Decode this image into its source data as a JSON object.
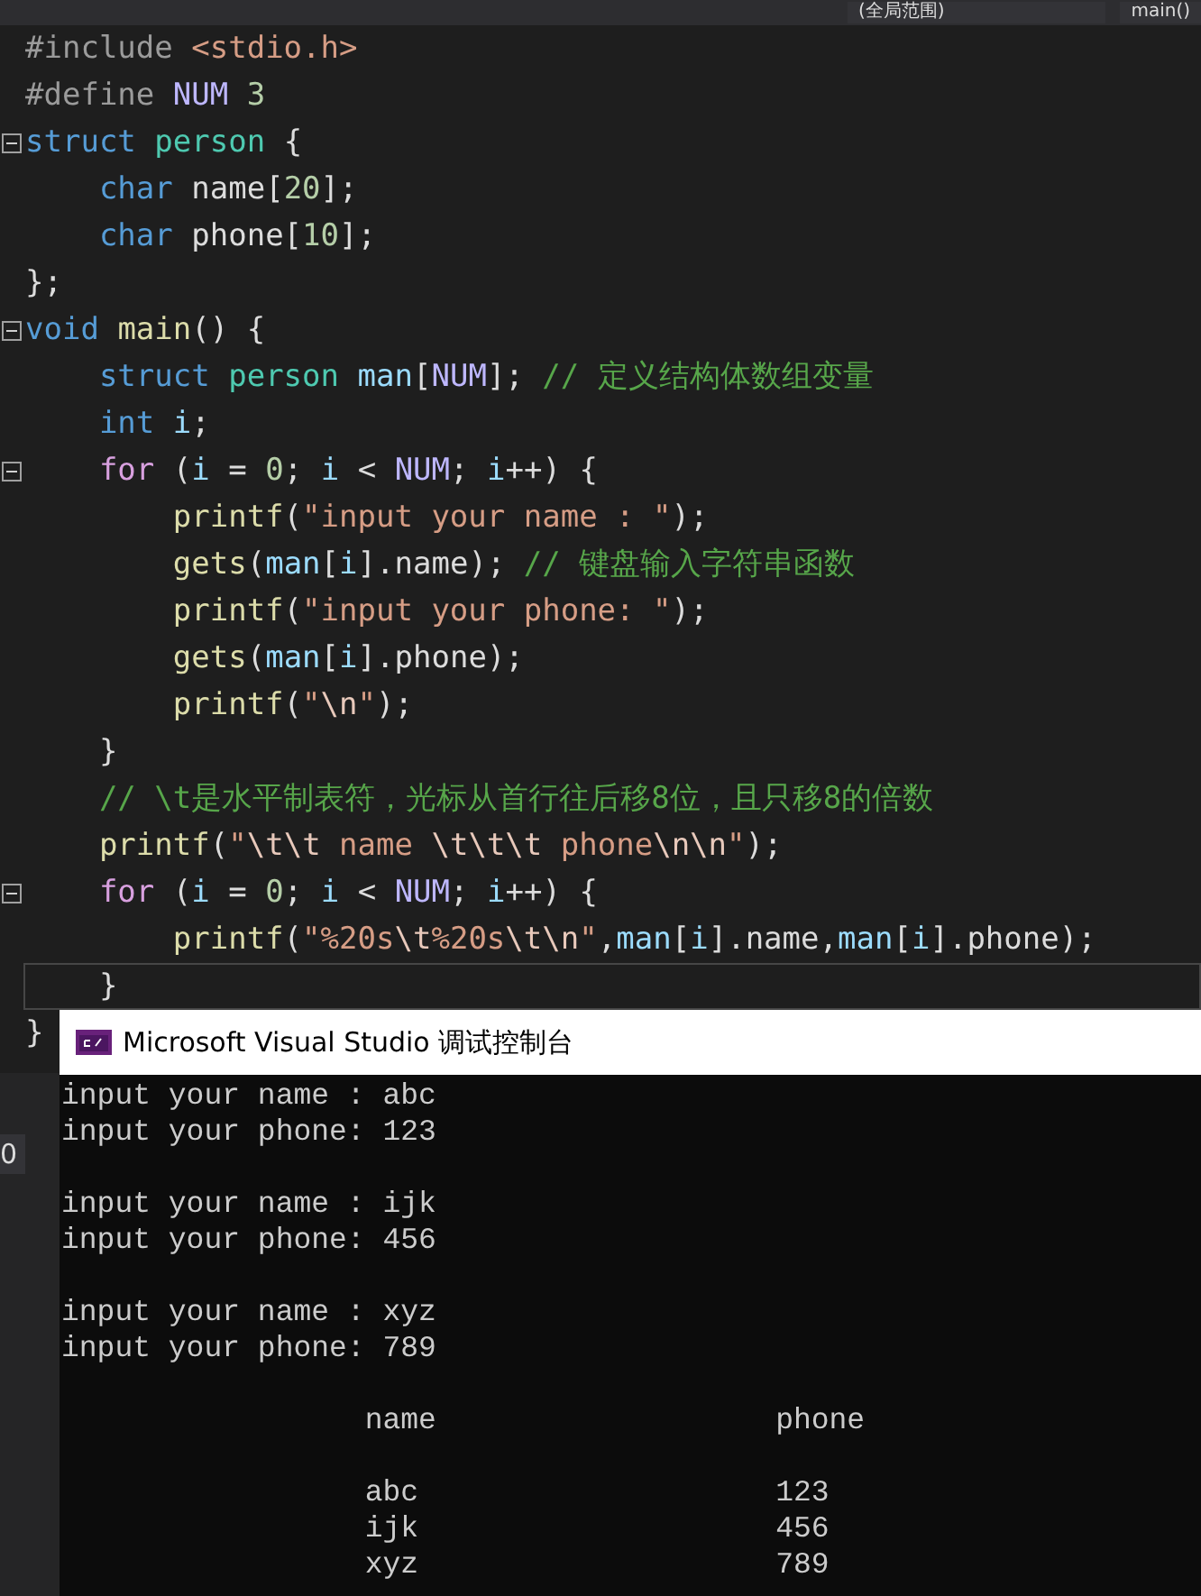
{
  "navigation_bar": {
    "scope_dropdown": "(全局范围)",
    "member_dropdown": "main()"
  },
  "editor": {
    "lines": [
      {
        "fold": false,
        "current": false,
        "tokens": [
          {
            "t": "#include ",
            "kind": "preproc"
          },
          {
            "t": "<stdio.h>",
            "kind": "string"
          }
        ]
      },
      {
        "fold": false,
        "current": false,
        "tokens": [
          {
            "t": "#define ",
            "kind": "preproc"
          },
          {
            "t": "NUM",
            "kind": "macro"
          },
          {
            "t": " 3",
            "kind": "number"
          }
        ]
      },
      {
        "fold": true,
        "current": false,
        "tokens": [
          {
            "t": "struct",
            "kind": "keyword"
          },
          {
            "t": " person",
            "kind": "type"
          },
          {
            "t": " {",
            "kind": "plain"
          }
        ]
      },
      {
        "fold": false,
        "current": false,
        "tokens": [
          {
            "t": "    char",
            "kind": "keyword"
          },
          {
            "t": " name[",
            "kind": "plain"
          },
          {
            "t": "20",
            "kind": "number"
          },
          {
            "t": "];",
            "kind": "plain"
          }
        ]
      },
      {
        "fold": false,
        "current": false,
        "tokens": [
          {
            "t": "    char",
            "kind": "keyword"
          },
          {
            "t": " phone[",
            "kind": "plain"
          },
          {
            "t": "10",
            "kind": "number"
          },
          {
            "t": "];",
            "kind": "plain"
          }
        ]
      },
      {
        "fold": false,
        "current": false,
        "tokens": [
          {
            "t": "};",
            "kind": "plain"
          }
        ]
      },
      {
        "fold": true,
        "current": false,
        "tokens": [
          {
            "t": "void",
            "kind": "keyword"
          },
          {
            "t": " main",
            "kind": "function"
          },
          {
            "t": "() {",
            "kind": "plain"
          }
        ]
      },
      {
        "fold": false,
        "current": false,
        "tokens": [
          {
            "t": "    struct",
            "kind": "keyword"
          },
          {
            "t": " person",
            "kind": "type"
          },
          {
            "t": " man",
            "kind": "variable"
          },
          {
            "t": "[",
            "kind": "plain"
          },
          {
            "t": "NUM",
            "kind": "macro"
          },
          {
            "t": "]; ",
            "kind": "plain"
          },
          {
            "t": "// 定义结构体数组变量",
            "kind": "comment"
          }
        ]
      },
      {
        "fold": false,
        "current": false,
        "tokens": [
          {
            "t": "    int",
            "kind": "keyword"
          },
          {
            "t": " i",
            "kind": "variable"
          },
          {
            "t": ";",
            "kind": "plain"
          }
        ]
      },
      {
        "fold": true,
        "current": false,
        "tokens": [
          {
            "t": "    for",
            "kind": "control"
          },
          {
            "t": " (",
            "kind": "plain"
          },
          {
            "t": "i",
            "kind": "variable"
          },
          {
            "t": " = ",
            "kind": "plain"
          },
          {
            "t": "0",
            "kind": "number"
          },
          {
            "t": "; ",
            "kind": "plain"
          },
          {
            "t": "i",
            "kind": "variable"
          },
          {
            "t": " < ",
            "kind": "plain"
          },
          {
            "t": "NUM",
            "kind": "macro"
          },
          {
            "t": "; ",
            "kind": "plain"
          },
          {
            "t": "i",
            "kind": "variable"
          },
          {
            "t": "++) {",
            "kind": "plain"
          }
        ]
      },
      {
        "fold": false,
        "current": false,
        "tokens": [
          {
            "t": "        printf",
            "kind": "function"
          },
          {
            "t": "(",
            "kind": "plain"
          },
          {
            "t": "\"input your name : \"",
            "kind": "string"
          },
          {
            "t": ");",
            "kind": "plain"
          }
        ]
      },
      {
        "fold": false,
        "current": false,
        "tokens": [
          {
            "t": "        gets",
            "kind": "function"
          },
          {
            "t": "(",
            "kind": "plain"
          },
          {
            "t": "man",
            "kind": "variable"
          },
          {
            "t": "[",
            "kind": "plain"
          },
          {
            "t": "i",
            "kind": "variable"
          },
          {
            "t": "].name); ",
            "kind": "plain"
          },
          {
            "t": "// 键盘输入字符串函数",
            "kind": "comment"
          }
        ]
      },
      {
        "fold": false,
        "current": false,
        "tokens": [
          {
            "t": "        printf",
            "kind": "function"
          },
          {
            "t": "(",
            "kind": "plain"
          },
          {
            "t": "\"input your phone: \"",
            "kind": "string"
          },
          {
            "t": ");",
            "kind": "plain"
          }
        ]
      },
      {
        "fold": false,
        "current": false,
        "tokens": [
          {
            "t": "        gets",
            "kind": "function"
          },
          {
            "t": "(",
            "kind": "plain"
          },
          {
            "t": "man",
            "kind": "variable"
          },
          {
            "t": "[",
            "kind": "plain"
          },
          {
            "t": "i",
            "kind": "variable"
          },
          {
            "t": "].phone);",
            "kind": "plain"
          }
        ]
      },
      {
        "fold": false,
        "current": false,
        "tokens": [
          {
            "t": "        printf",
            "kind": "function"
          },
          {
            "t": "(",
            "kind": "plain"
          },
          {
            "t": "\"",
            "kind": "string"
          },
          {
            "t": "\\n",
            "kind": "escape"
          },
          {
            "t": "\"",
            "kind": "string"
          },
          {
            "t": ");",
            "kind": "plain"
          }
        ]
      },
      {
        "fold": false,
        "current": false,
        "tokens": [
          {
            "t": "    }",
            "kind": "plain"
          }
        ]
      },
      {
        "fold": false,
        "current": false,
        "tokens": [
          {
            "t": "    // \\t是水平制表符，光标从首行往后移8位，且只移8的倍数",
            "kind": "comment"
          }
        ]
      },
      {
        "fold": false,
        "current": false,
        "tokens": [
          {
            "t": "    printf",
            "kind": "function"
          },
          {
            "t": "(",
            "kind": "plain"
          },
          {
            "t": "\"",
            "kind": "string"
          },
          {
            "t": "\\t\\t",
            "kind": "escape"
          },
          {
            "t": " name ",
            "kind": "string"
          },
          {
            "t": "\\t\\t\\t",
            "kind": "escape"
          },
          {
            "t": " phone",
            "kind": "string"
          },
          {
            "t": "\\n\\n",
            "kind": "escape"
          },
          {
            "t": "\"",
            "kind": "string"
          },
          {
            "t": ");",
            "kind": "plain"
          }
        ]
      },
      {
        "fold": true,
        "current": false,
        "tokens": [
          {
            "t": "    for",
            "kind": "control"
          },
          {
            "t": " (",
            "kind": "plain"
          },
          {
            "t": "i",
            "kind": "variable"
          },
          {
            "t": " = ",
            "kind": "plain"
          },
          {
            "t": "0",
            "kind": "number"
          },
          {
            "t": "; ",
            "kind": "plain"
          },
          {
            "t": "i",
            "kind": "variable"
          },
          {
            "t": " < ",
            "kind": "plain"
          },
          {
            "t": "NUM",
            "kind": "macro"
          },
          {
            "t": "; ",
            "kind": "plain"
          },
          {
            "t": "i",
            "kind": "variable"
          },
          {
            "t": "++) {",
            "kind": "plain"
          }
        ]
      },
      {
        "fold": false,
        "current": false,
        "tokens": [
          {
            "t": "        printf",
            "kind": "function"
          },
          {
            "t": "(",
            "kind": "plain"
          },
          {
            "t": "\"%20s",
            "kind": "string"
          },
          {
            "t": "\\t",
            "kind": "escape"
          },
          {
            "t": "%20s",
            "kind": "string"
          },
          {
            "t": "\\t\\n",
            "kind": "escape"
          },
          {
            "t": "\"",
            "kind": "string"
          },
          {
            "t": ",",
            "kind": "plain"
          },
          {
            "t": "man",
            "kind": "variable"
          },
          {
            "t": "[",
            "kind": "plain"
          },
          {
            "t": "i",
            "kind": "variable"
          },
          {
            "t": "].name,",
            "kind": "plain"
          },
          {
            "t": "man",
            "kind": "variable"
          },
          {
            "t": "[",
            "kind": "plain"
          },
          {
            "t": "i",
            "kind": "variable"
          },
          {
            "t": "].phone);",
            "kind": "plain"
          }
        ]
      },
      {
        "fold": false,
        "current": true,
        "tokens": [
          {
            "t": "    }",
            "kind": "plain"
          }
        ]
      },
      {
        "fold": false,
        "current": false,
        "tokens": [
          {
            "t": "}",
            "kind": "plain"
          }
        ]
      }
    ]
  },
  "side_panel": {
    "fragment": "0"
  },
  "console": {
    "title": "Microsoft Visual Studio 调试控制台",
    "lines": [
      {
        "kind": "text",
        "text": "input your name : abc"
      },
      {
        "kind": "text",
        "text": "input your phone: 123"
      },
      {
        "kind": "blank"
      },
      {
        "kind": "text",
        "text": "input your name : ijk"
      },
      {
        "kind": "text",
        "text": "input your phone: 456"
      },
      {
        "kind": "blank"
      },
      {
        "kind": "text",
        "text": "input your name : xyz"
      },
      {
        "kind": "text",
        "text": "input your phone: 789"
      },
      {
        "kind": "blank"
      },
      {
        "kind": "text",
        "text": "                 name                   phone"
      },
      {
        "kind": "blank"
      },
      {
        "kind": "text",
        "text": "                 abc                    123"
      },
      {
        "kind": "text",
        "text": "                 ijk                    456"
      },
      {
        "kind": "text",
        "text": "                 xyz                    789"
      }
    ]
  }
}
